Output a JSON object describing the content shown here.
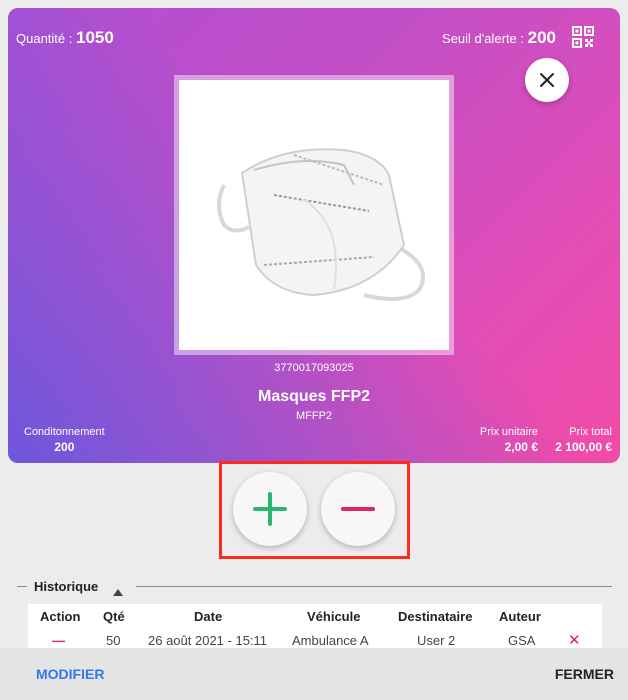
{
  "card": {
    "quantity_label": "Quantité : ",
    "quantity_value": "1050",
    "threshold_label": "Seuil d'alerte : ",
    "threshold_value": "200",
    "barcode": "3770017093025",
    "product_name": "Masques FFP2",
    "product_ref": "MFFP2",
    "packaging_label": "Conditonnement",
    "packaging_value": "200",
    "unit_price_label": "Prix unitaire",
    "unit_price_value": "2,00 €",
    "total_price_label": "Prix total",
    "total_price_value": "2 100,00 €"
  },
  "history": {
    "title": "Historique",
    "columns": [
      "Action",
      "Qté",
      "Date",
      "Véhicule",
      "Destinataire",
      "Auteur"
    ],
    "rows": [
      {
        "action": "—",
        "qty": "50",
        "date": "26 août 2021 - 15:11",
        "vehicle": "Ambulance A",
        "recipient": "User 2",
        "author": "GSA",
        "delete": "✕"
      }
    ]
  },
  "footer": {
    "modify_label": "MODIFIER",
    "close_label": "FERMER"
  },
  "colors": {
    "accent_blue": "#2f7be8",
    "plus_green": "#2bb673",
    "minus_red": "#e0245e",
    "highlight_red": "#ff2a1a"
  }
}
